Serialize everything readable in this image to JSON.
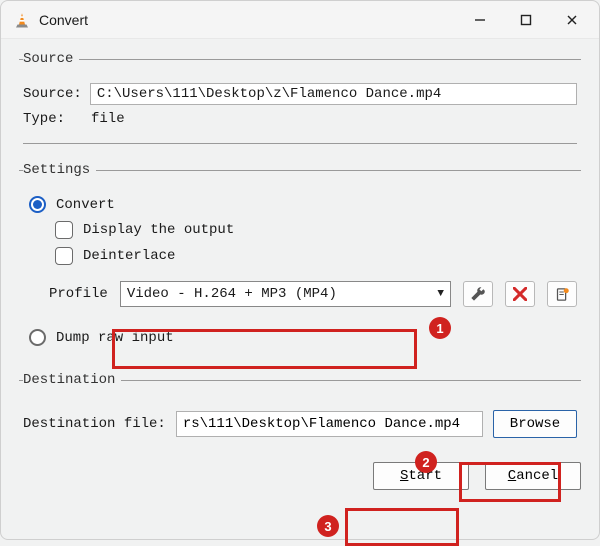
{
  "window": {
    "title": "Convert"
  },
  "source": {
    "legend": "Source",
    "source_label": "Source:",
    "source_value": "C:\\Users\\111\\Desktop\\z\\Flamenco Dance.mp4",
    "type_label": "Type:",
    "type_value": "file"
  },
  "settings": {
    "legend": "Settings",
    "convert_label": "Convert",
    "display_output_label": "Display the output",
    "deinterlace_label": "Deinterlace",
    "profile_label": "Profile",
    "profile_value": "Video - H.264 + MP3 (MP4)",
    "dump_label": "Dump raw input"
  },
  "destination": {
    "legend": "Destination",
    "dest_label": "Destination file:",
    "dest_value": "rs\\111\\Desktop\\Flamenco Dance.mp4",
    "browse_label": "Browse"
  },
  "buttons": {
    "start_prefix": "S",
    "start_rest": "tart",
    "cancel_prefix": "C",
    "cancel_rest": "ancel"
  },
  "annotations": {
    "b1": "1",
    "b2": "2",
    "b3": "3"
  }
}
